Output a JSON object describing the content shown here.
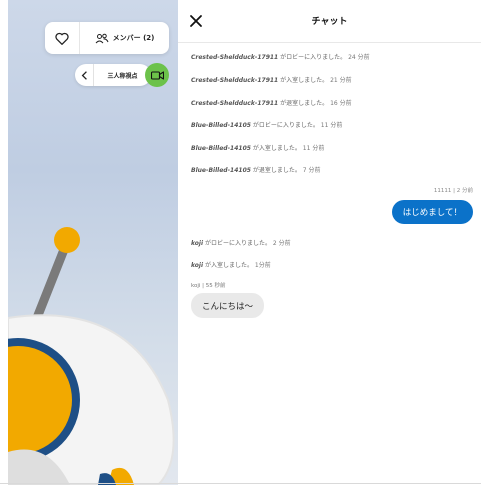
{
  "viewport": {
    "members_label": "メンバー (2)",
    "view_mode_label": "三人称視点"
  },
  "chat": {
    "title": "チャット",
    "system_messages": [
      {
        "user": "Crested-Sheldduck-17911",
        "text": "がロビーに入りました。",
        "time": "24 分前"
      },
      {
        "user": "Crested-Sheldduck-17911",
        "text": "が入室しました。",
        "time": "21 分前"
      },
      {
        "user": "Crested-Sheldduck-17911",
        "text": "が退室しました。",
        "time": "16 分前"
      },
      {
        "user": "Blue-Billed-14105",
        "text": "がロビーに入りました。",
        "time": "11 分前"
      },
      {
        "user": "Blue-Billed-14105",
        "text": "が入室しました。",
        "time": "11 分前"
      },
      {
        "user": "Blue-Billed-14105",
        "text": "が退室しました。",
        "time": "7 分前"
      }
    ],
    "my_message": {
      "meta": "11111 | 2 分前",
      "text": "はじめまして！"
    },
    "later_messages": [
      {
        "user": "koji",
        "text": "がロビーに入りました。",
        "time": "2 分前"
      },
      {
        "user": "koji",
        "text": "が入室しました。",
        "time": "1分前"
      }
    ],
    "other_message": {
      "meta": "koji | 55 秒前",
      "text": "こんにちは〜"
    }
  },
  "colors": {
    "accent_blue": "#0b72c9",
    "camera_green": "#6cc24a",
    "robot_orange": "#f2a900"
  },
  "icons": [
    "heart-icon",
    "people-icon",
    "chevron-left-icon",
    "video-camera-icon",
    "close-icon"
  ]
}
